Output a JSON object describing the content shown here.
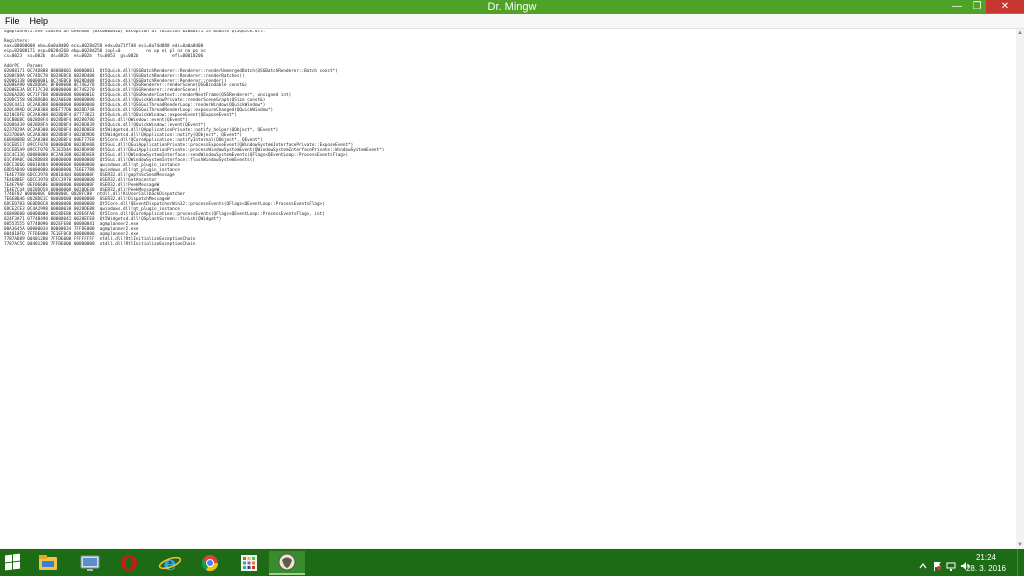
{
  "window": {
    "title": "Dr. Mingw",
    "minimize": "—",
    "maximize": "❐",
    "close": "✕"
  },
  "menu": {
    "file": "File",
    "help": "Help"
  },
  "report": [
    "agmplanner2.exe caused an Unknown [0xC000041D] Exception at location 02088171 in module Qt5Quick.dll.",
    "",
    "Registers:",
    "eax=00000000 ebx=0a0a8d00 ecx=0028d258 edx=0a71f7d8 esi=0a74d888 edi=0a0a8d00",
    "eip=02088171 esp=0028d260 ebp=0028d258 iopl=0          nv up ei pl nz na po nc",
    "cs=0023  ss=002b  ds=002b  es=002b  fs=0053  gs=002b             efl=00010206",
    "",
    "AddrPC   Params",
    "02088171 0C74D888 00000001 00000001  Qt5Quick.dll!QSGBatchRenderer::Renderer::renderUnmergedBatch(QSGBatchRenderer::Batch const*)",
    "0208C09A 0C74DC70 0028EBC0 0028D408  Qt5Quick.dll!QSGBatchRenderer::Renderer::renderBatches()",
    "02086138 00000001 0C74EBC0 0028D408  Qt5Quick.dll!QSGBatchRenderer::Renderer::render()",
    "0208EA90 0028D6AC BF800000 0C74E270  Qt5Quick.dll!QSGRenderer::renderScene(QSGBindable const&)",
    "0208EE3A BCF17C38 00000000 0C74E270  Qt5Quick.dll!QSGRenderer::renderScene()",
    "0206A2D6 0C71F7D8 00000000 0000001E  Qt5Quick.dll!QSGRenderContext::renderNextFrame(QSGRenderer*, unsigned int)",
    "020DC558 0028D6B0 002A0E00 00000000  Qt5Quick.dll!QQuickWindowPrivate::renderSceneGraph(QSize const&)",
    "020C4411 0C2A8308 00000000 00000000  Qt5Quick.dll!QSGGuiThreadRenderLoop::renderWindow(QQuickWindow*)",
    "020C49AD 0C2A8308 08EF77D8 0028D748  Qt5Quick.dll!QSGGuiThreadRenderLoop::exposureChanged(QQuickWindow*)",
    "0210C0FE 0C2A8308 0028D8F4 07773822  Qt5Quick.dll!QQuickWindow::exposeEvent(QExposeEvent*)",
    "01CBB6BC 0028D8F4 0028D8F4 00280786  Qt5Gui.dll!QWindow::event(QEvent*)",
    "02086439 0028D8F4 0028D8F4 0028D839  Qt5Quick.dll!QQuickWindow::event(QEvent*)",
    "0237829A 0C2A8308 0028D8F4 0028D8E8  Qt5Widgetsd.dll!QApplicationPrivate::notify_helper(QObject*, QEvent*)",
    "0237D60A 0C2A8308 0028D8F4 0028D9D8  Qt5Widgetsd.dll!QApplication::notify(QObject*, QEvent*)",
    "668AB0DB 0C2A8308 0028D8F4 08EF77E8  Qt5Core.dll!QCoreApplication::notifyInternal(QObject*, QEvent*)",
    "01CEB517 09CCF070 000000D0 0028DA08  Qt5Gui.dll!QGuiApplicationPrivate::processExposeEvent(QWindowSystemInterfacePrivate::ExposeEvent*)",
    "01CEB5A9 09CCF070 7E1E2D4A 0028DA90  Qt5Gui.dll!QGuiApplicationPrivate::processWindowSystemEvent(QWindowSystemInterfacePrivate::WindowSystemEvent*)",
    "01C4C336 00000000 0C2A8308 0028DAE8  Qt5Gui.dll!QWindowSystemInterface::sendWindowSystemEvents(QFlags<QEventLoop::ProcessEventsFlag>)",
    "01C49A0C 0028DB48 00000000 00000000  Qt5Gui.dll!QWindowSystemInterface::flushWindowSystemEvents()",
    "6DCC3666 00010404 00000008 00000000  qwindows.dll!qt_plugin_instance",
    "6DD5AB40 00000000 00000000 7E6E77B8  qwindows.dll!qt_plugin_instance",
    "7E4E77D8 6DCC3970 00010404 0000000F  USER32.dll!gapfnScSendMessage",
    "7E4E8BEF 6DCC3970 6DCC3970 00000000  USER32.dll!GetAncestor",
    "7E4E79AF 0EF0668E 00000000 0000000F  USER32.dll!PeekMessageW",
    "7E4E7C44 0028DD58 00000000 0028DE48  USER32.dll!PeekMessageW",
    "7746F02 0000000C 0000000C 0028FC08  ntdll.dll!KiUserCallbackDispatcher",
    "7E6E8B46 0028DE1C 00000000 00000000  USER32.dll!DispatchMessageW",
    "6DCED703 0E8DD6C8 00000000 00000000  Qt5Core.dll!QEventDispatcherWin32::processEvents(QFlags<QEventLoop::ProcessEventsFlag>)",
    "6DCE2CE3 0C4A2998 00000038 0028DE88  qwindows.dll!qt_plugin_instance",
    "668AB600 00000000 0028DE88 028E6FA8  Qt5Core.dll!QCoreApplication::processEvents(QFlags<QEventLoop::ProcessEventsFlag>, int)",
    "024F3A71 0774B490 00000041 0028EFE8  Qt5Widgetsd.dll!QSplashScreen::finish(QWidget*)",
    "00553555 0774B090 002EFE80 00000041  agmplanner2.exe",
    "00A3645A 00000034 00000034 7FFDE000  agmplanner2.exe",
    "004010FD 7FFDE000 7E1EF0C8 00000000  agmplanner2.exe",
    "7787AD89 00401280 7FFDE000 FFFFFFFF  ntdll.dll!RtlInitializeExceptionChain",
    "7787AC5C 00401280 7FFDE000 00000000  ntdll.dll!RtlInitializeExceptionChain"
  ],
  "taskbar": {
    "items": [
      "file-explorer",
      "remote-desktop",
      "opera",
      "internet-explorer",
      "chrome",
      "app-grid",
      "dr-mingw"
    ],
    "active": "dr-mingw",
    "time": "21:24",
    "date": "28. 3. 2016"
  },
  "colors": {
    "titlebar": "#4ea327",
    "taskbar": "#1d6b15",
    "close": "#c7372f"
  }
}
